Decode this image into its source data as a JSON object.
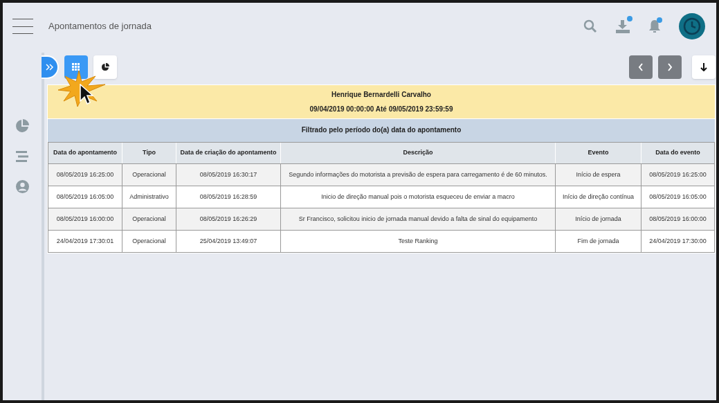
{
  "header": {
    "title": "Apontamentos de jornada",
    "downloads_badge": true,
    "notifications_badge": true
  },
  "view_buttons": [
    {
      "kind": "grid",
      "selected": true
    },
    {
      "kind": "pie",
      "selected": false
    }
  ],
  "report": {
    "name": "Henrique Bernardelli Carvalho",
    "period": "09/04/2019 00:00:00 Até 09/05/2019 23:59:59",
    "filter": "Filtrado pelo período do(a) data do apontamento"
  },
  "table": {
    "columns": [
      "Data do apontamento",
      "Tipo",
      "Data de criação do apontamento",
      "Descrição",
      "Evento",
      "Data do evento"
    ],
    "rows": [
      [
        "08/05/2019 16:25:00",
        "Operacional",
        "08/05/2019 16:30:17",
        "Segundo informações do motorista a previsão de espera para carregamento é de 60 minutos.",
        "Início de espera",
        "08/05/2019 16:25:00"
      ],
      [
        "08/05/2019 16:05:00",
        "Administrativo",
        "08/05/2019 16:28:59",
        "Inicio de direção manual pois o motorista esqueceu de enviar a macro",
        "Início de direção contínua",
        "08/05/2019 16:05:00"
      ],
      [
        "08/05/2019 16:00:00",
        "Operacional",
        "08/05/2019 16:26:29",
        "Sr Francisco, solicitou inicio de jornada manual devido a falta de sinal do equipamento",
        "Início de jornada",
        "08/05/2019 16:00:00"
      ],
      [
        "24/04/2019 17:30:01",
        "Operacional",
        "25/04/2019 13:49:07",
        "Teste Ranking",
        "Fim de jornada",
        "24/04/2019 17:30:00"
      ]
    ]
  }
}
